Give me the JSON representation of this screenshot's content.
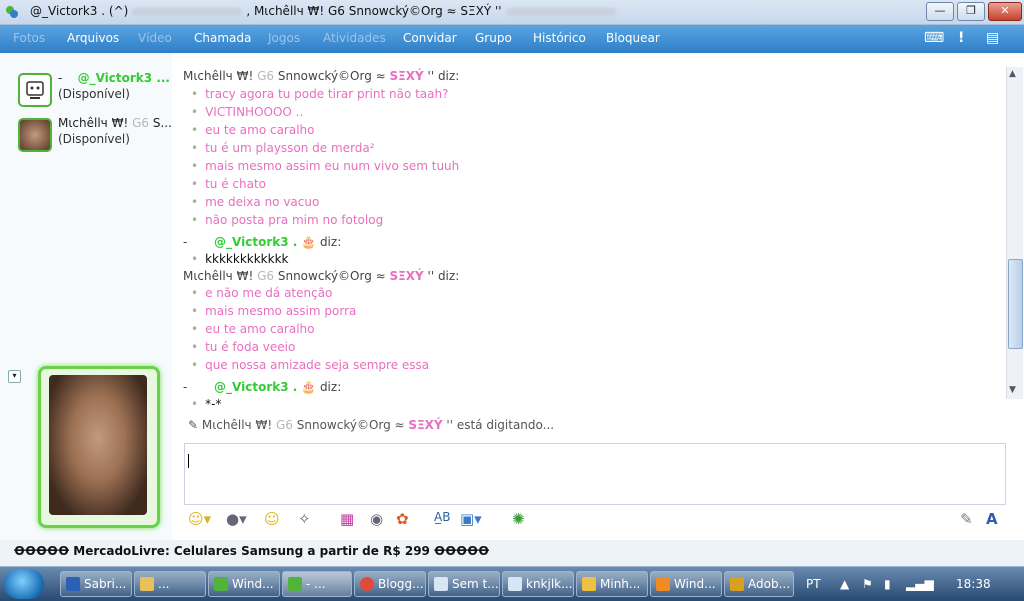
{
  "window": {
    "title_prefix": "@_Victork3 . (^)",
    "title_suffix": ", Mιchêllч ₩! G6 Snnowcký©Org ≈ SΞXÝ ''",
    "buttons": {
      "minimize": "—",
      "restore": "❐",
      "close": "✕"
    }
  },
  "menu": {
    "items": [
      {
        "label": "Fotos",
        "disabled": true
      },
      {
        "label": "Arquivos",
        "disabled": false
      },
      {
        "label": "Vídeo",
        "disabled": true
      },
      {
        "label": "Chamada",
        "disabled": false
      },
      {
        "label": "Jogos",
        "disabled": true
      },
      {
        "label": "Atividades",
        "disabled": true
      },
      {
        "label": "Convidar",
        "disabled": false
      },
      {
        "label": "Grupo",
        "disabled": false
      },
      {
        "label": "Histórico",
        "disabled": false
      },
      {
        "label": "Bloquear",
        "disabled": false
      }
    ]
  },
  "contacts": [
    {
      "dash": "-",
      "name": "@_Victork3 ...",
      "status": "(Disponível)"
    },
    {
      "name_a": "Mιchêllч ₩!",
      "name_b": "G6",
      "name_c": "S...",
      "status": "(Disponível)"
    }
  ],
  "sender_a": {
    "a": "Mιchêllч ₩!",
    "b": "G6",
    "c": "Snnowcký©Org ≈",
    "d": "SΞXÝ",
    "e": "'' diz:"
  },
  "sender_b": {
    "a": "-",
    "b": "@_Victork3 .",
    "c": "diz:"
  },
  "conversation": {
    "block1": [
      "tracy agora tu pode tirar print não taah?",
      "VICTINHOOOO ..",
      "eu te amo caralho",
      "tu é um playsson de merda²",
      "mais mesmo assim eu num vivo sem tuuh",
      "tu é chato",
      "me deixa no vacuo",
      "não posta pra mim no fotolog"
    ],
    "block2": [
      "kkkkkkkkkkkk"
    ],
    "block3": [
      "e não me dá atenção",
      "mais mesmo assim porra",
      "eu te amo caralho",
      "tu é foda veeio",
      "que nossa amizade seja sempre essa"
    ],
    "block4": [
      "*-*"
    ]
  },
  "typing": {
    "a": "Mιchêllч ₩!",
    "b": "G6",
    "c": "Snnowcký©Org ≈",
    "d": "SΞXÝ",
    "e": "'' está digitando..."
  },
  "ad": {
    "text": "ꝊꝊꝊꝊꝊ  MercadoLivre: Celulares Samsung a partir de R$ 299  ꝊꝊꝊꝊꝊ"
  },
  "taskbar": {
    "tasks": [
      {
        "label": "Sabri...",
        "color": "#2b5fb8"
      },
      {
        "label": "...",
        "color": "#e8c15a"
      },
      {
        "label": "Wind...",
        "color": "#4fb33c"
      },
      {
        "label": "- ...",
        "color": "#4fb33c"
      },
      {
        "label": "Blogg...",
        "color": "#e24a3b"
      },
      {
        "label": "Sem t...",
        "color": "#d7e6f4"
      },
      {
        "label": "knkjlk...",
        "color": "#d7e6f4"
      },
      {
        "label": "Minh...",
        "color": "#f0c040"
      },
      {
        "label": "Wind...",
        "color": "#f08a24"
      },
      {
        "label": "Adob...",
        "color": "#d8a020"
      }
    ],
    "lang": "PT",
    "clock": "18:38"
  },
  "colors": {
    "menubar": "#3f8fd6",
    "pink": "#e86fc0",
    "green": "#33cc33"
  }
}
